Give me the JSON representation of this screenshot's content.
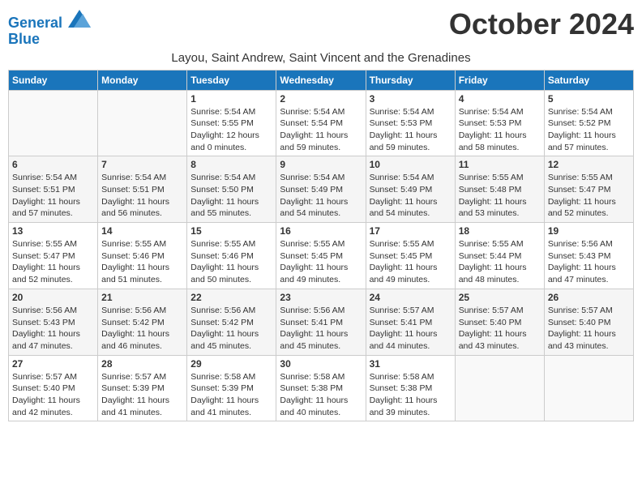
{
  "header": {
    "logo_line1": "General",
    "logo_line2": "Blue",
    "month_title": "October 2024",
    "subtitle": "Layou, Saint Andrew, Saint Vincent and the Grenadines"
  },
  "days_of_week": [
    "Sunday",
    "Monday",
    "Tuesday",
    "Wednesday",
    "Thursday",
    "Friday",
    "Saturday"
  ],
  "weeks": [
    [
      {
        "day": "",
        "detail": ""
      },
      {
        "day": "",
        "detail": ""
      },
      {
        "day": "1",
        "detail": "Sunrise: 5:54 AM\nSunset: 5:55 PM\nDaylight: 12 hours\nand 0 minutes."
      },
      {
        "day": "2",
        "detail": "Sunrise: 5:54 AM\nSunset: 5:54 PM\nDaylight: 11 hours\nand 59 minutes."
      },
      {
        "day": "3",
        "detail": "Sunrise: 5:54 AM\nSunset: 5:53 PM\nDaylight: 11 hours\nand 59 minutes."
      },
      {
        "day": "4",
        "detail": "Sunrise: 5:54 AM\nSunset: 5:53 PM\nDaylight: 11 hours\nand 58 minutes."
      },
      {
        "day": "5",
        "detail": "Sunrise: 5:54 AM\nSunset: 5:52 PM\nDaylight: 11 hours\nand 57 minutes."
      }
    ],
    [
      {
        "day": "6",
        "detail": "Sunrise: 5:54 AM\nSunset: 5:51 PM\nDaylight: 11 hours\nand 57 minutes."
      },
      {
        "day": "7",
        "detail": "Sunrise: 5:54 AM\nSunset: 5:51 PM\nDaylight: 11 hours\nand 56 minutes."
      },
      {
        "day": "8",
        "detail": "Sunrise: 5:54 AM\nSunset: 5:50 PM\nDaylight: 11 hours\nand 55 minutes."
      },
      {
        "day": "9",
        "detail": "Sunrise: 5:54 AM\nSunset: 5:49 PM\nDaylight: 11 hours\nand 54 minutes."
      },
      {
        "day": "10",
        "detail": "Sunrise: 5:54 AM\nSunset: 5:49 PM\nDaylight: 11 hours\nand 54 minutes."
      },
      {
        "day": "11",
        "detail": "Sunrise: 5:55 AM\nSunset: 5:48 PM\nDaylight: 11 hours\nand 53 minutes."
      },
      {
        "day": "12",
        "detail": "Sunrise: 5:55 AM\nSunset: 5:47 PM\nDaylight: 11 hours\nand 52 minutes."
      }
    ],
    [
      {
        "day": "13",
        "detail": "Sunrise: 5:55 AM\nSunset: 5:47 PM\nDaylight: 11 hours\nand 52 minutes."
      },
      {
        "day": "14",
        "detail": "Sunrise: 5:55 AM\nSunset: 5:46 PM\nDaylight: 11 hours\nand 51 minutes."
      },
      {
        "day": "15",
        "detail": "Sunrise: 5:55 AM\nSunset: 5:46 PM\nDaylight: 11 hours\nand 50 minutes."
      },
      {
        "day": "16",
        "detail": "Sunrise: 5:55 AM\nSunset: 5:45 PM\nDaylight: 11 hours\nand 49 minutes."
      },
      {
        "day": "17",
        "detail": "Sunrise: 5:55 AM\nSunset: 5:45 PM\nDaylight: 11 hours\nand 49 minutes."
      },
      {
        "day": "18",
        "detail": "Sunrise: 5:55 AM\nSunset: 5:44 PM\nDaylight: 11 hours\nand 48 minutes."
      },
      {
        "day": "19",
        "detail": "Sunrise: 5:56 AM\nSunset: 5:43 PM\nDaylight: 11 hours\nand 47 minutes."
      }
    ],
    [
      {
        "day": "20",
        "detail": "Sunrise: 5:56 AM\nSunset: 5:43 PM\nDaylight: 11 hours\nand 47 minutes."
      },
      {
        "day": "21",
        "detail": "Sunrise: 5:56 AM\nSunset: 5:42 PM\nDaylight: 11 hours\nand 46 minutes."
      },
      {
        "day": "22",
        "detail": "Sunrise: 5:56 AM\nSunset: 5:42 PM\nDaylight: 11 hours\nand 45 minutes."
      },
      {
        "day": "23",
        "detail": "Sunrise: 5:56 AM\nSunset: 5:41 PM\nDaylight: 11 hours\nand 45 minutes."
      },
      {
        "day": "24",
        "detail": "Sunrise: 5:57 AM\nSunset: 5:41 PM\nDaylight: 11 hours\nand 44 minutes."
      },
      {
        "day": "25",
        "detail": "Sunrise: 5:57 AM\nSunset: 5:40 PM\nDaylight: 11 hours\nand 43 minutes."
      },
      {
        "day": "26",
        "detail": "Sunrise: 5:57 AM\nSunset: 5:40 PM\nDaylight: 11 hours\nand 43 minutes."
      }
    ],
    [
      {
        "day": "27",
        "detail": "Sunrise: 5:57 AM\nSunset: 5:40 PM\nDaylight: 11 hours\nand 42 minutes."
      },
      {
        "day": "28",
        "detail": "Sunrise: 5:57 AM\nSunset: 5:39 PM\nDaylight: 11 hours\nand 41 minutes."
      },
      {
        "day": "29",
        "detail": "Sunrise: 5:58 AM\nSunset: 5:39 PM\nDaylight: 11 hours\nand 41 minutes."
      },
      {
        "day": "30",
        "detail": "Sunrise: 5:58 AM\nSunset: 5:38 PM\nDaylight: 11 hours\nand 40 minutes."
      },
      {
        "day": "31",
        "detail": "Sunrise: 5:58 AM\nSunset: 5:38 PM\nDaylight: 11 hours\nand 39 minutes."
      },
      {
        "day": "",
        "detail": ""
      },
      {
        "day": "",
        "detail": ""
      }
    ]
  ]
}
